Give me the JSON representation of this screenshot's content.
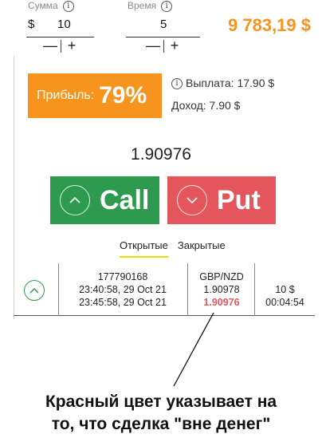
{
  "amount": {
    "label": "Сумма",
    "currency": "$",
    "value": "10",
    "minus": "—",
    "plus": "+"
  },
  "time": {
    "label": "Время",
    "value": "5",
    "minus": "—",
    "plus": "+"
  },
  "balance": "9 783,19 $",
  "profit": {
    "label": "Прибыль:",
    "percent": "79%"
  },
  "payout": "Выплата: 17.90 $",
  "income": "Доход: 7.90 $",
  "current_price": "1.90976",
  "call_button": {
    "label": "Call",
    "color": "#2e9a4f"
  },
  "put_button": {
    "label": "Put",
    "color": "#e5565c"
  },
  "tabs": [
    {
      "label": "Открытые",
      "active": true
    },
    {
      "label": "Закрытые",
      "active": false
    }
  ],
  "deal": {
    "id": "177790168",
    "open_time": "23:40:58, 29 Oct 21",
    "close_time": "23:45:58, 29 Oct 21",
    "pair": "GBP/NZD",
    "open_price": "1.90978",
    "current_price": "1.90976",
    "amount": "10 $",
    "remaining": "00:04:54",
    "direction_icon": "chevron-up-icon"
  },
  "annotation": {
    "line1": "Красный цвет указывает на",
    "line2": "то, что сделка \"вне денег\""
  },
  "colors": {
    "accent": "#f7931e",
    "call": "#2e9a4f",
    "put": "#e5565c",
    "tab_underline": "#e7e000"
  }
}
